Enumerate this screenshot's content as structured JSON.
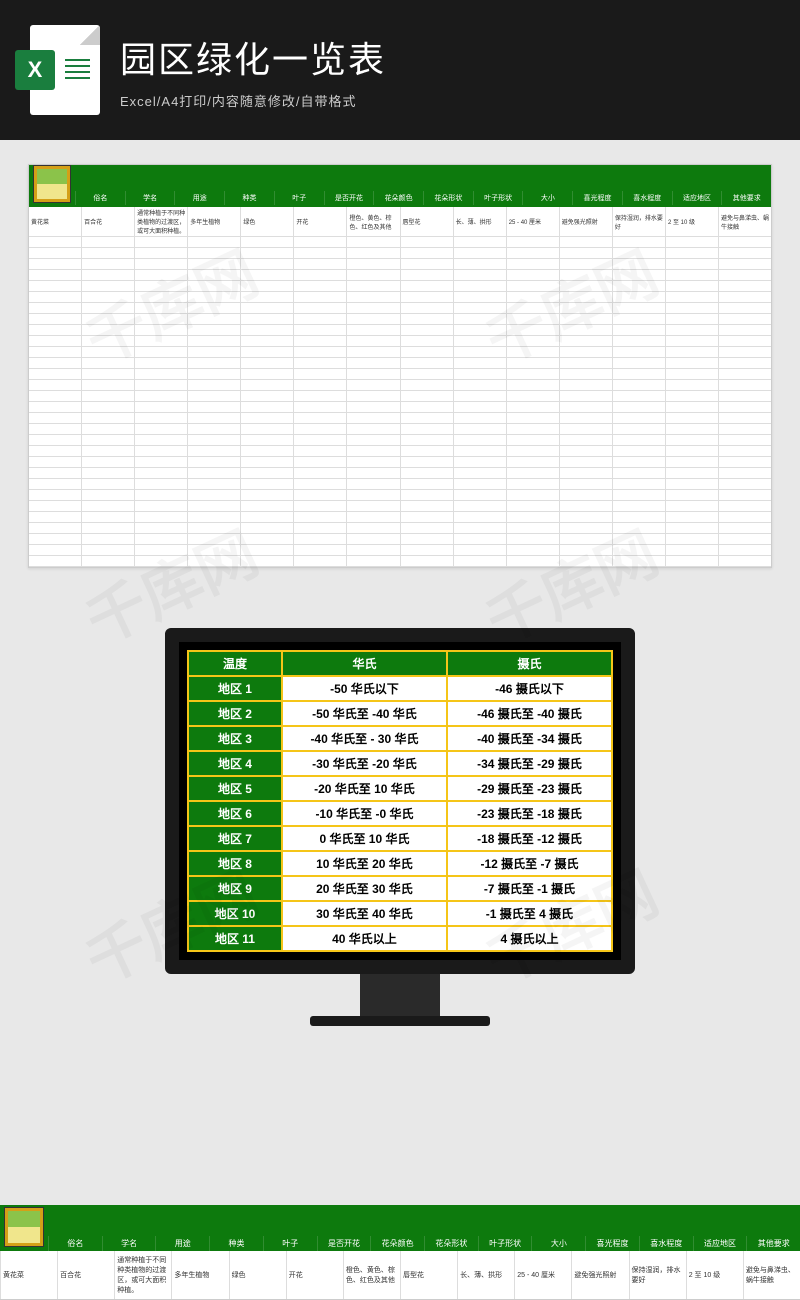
{
  "header": {
    "title": "园区绿化一览表",
    "subtitle": "Excel/A4打印/内容随意修改/自带格式",
    "icon_label": "X"
  },
  "spreadsheet": {
    "columns": [
      "俗名",
      "学名",
      "用途",
      "种类",
      "叶子",
      "是否开花",
      "花朵颜色",
      "花朵形状",
      "叶子形状",
      "大小",
      "喜光程度",
      "喜水程度",
      "适应地区",
      "其他要求"
    ],
    "data_row": [
      "黄花菜",
      "百合花",
      "通常种植于不同种类植物的过渡区，或可大面积种植。",
      "多年生植物",
      "绿色",
      "开花",
      "橙色、黄色、棕色、红色及其他",
      "唇型花",
      "长、薄、拱形",
      "25 - 40 厘米",
      "避免强光照射",
      "保持湿润，排水要好",
      "2 至 10 级",
      "避免与鼻涕虫、蜗牛接触"
    ],
    "empty_rows": 30
  },
  "temperature_table": {
    "headers": [
      "温度",
      "华氏",
      "摄氏"
    ],
    "rows": [
      {
        "zone": "地区 1",
        "f": "-50 华氏以下",
        "c": "-46 摄氏以下"
      },
      {
        "zone": "地区 2",
        "f": "-50 华氏至 -40 华氏",
        "c": "-46 摄氏至 -40 摄氏"
      },
      {
        "zone": "地区 3",
        "f": "-40 华氏至 - 30 华氏",
        "c": "-40 摄氏至 -34 摄氏"
      },
      {
        "zone": "地区 4",
        "f": "-30 华氏至 -20 华氏",
        "c": "-34 摄氏至 -29 摄氏"
      },
      {
        "zone": "地区 5",
        "f": "-20 华氏至 10 华氏",
        "c": "-29 摄氏至 -23 摄氏"
      },
      {
        "zone": "地区 6",
        "f": "-10 华氏至 -0 华氏",
        "c": "-23 摄氏至 -18 摄氏"
      },
      {
        "zone": "地区 7",
        "f": "0 华氏至 10 华氏",
        "c": "-18 摄氏至 -12 摄氏"
      },
      {
        "zone": "地区 8",
        "f": "10 华氏至 20 华氏",
        "c": "-12 摄氏至 -7 摄氏"
      },
      {
        "zone": "地区 9",
        "f": "20 华氏至 30 华氏",
        "c": "-7 摄氏至 -1 摄氏"
      },
      {
        "zone": "地区 10",
        "f": "30 华氏至 40 华氏",
        "c": "-1 摄氏至 4 摄氏"
      },
      {
        "zone": "地区 11",
        "f": "40 华氏以上",
        "c": "4 摄氏以上"
      }
    ]
  },
  "watermark": "千库网"
}
